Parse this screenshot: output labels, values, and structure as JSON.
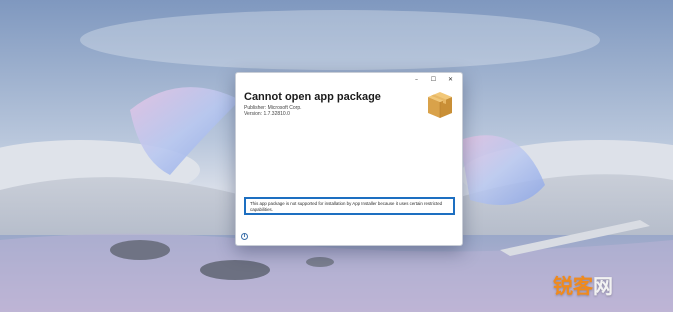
{
  "dialog": {
    "title": "Cannot open app package",
    "publisher": "Publisher: Microsoft Corp.",
    "version": "Version: 1.7.32810.0",
    "message": "This app package is not supported for installation by App Installer because it uses certain restricted capabilities.",
    "controls": {
      "minimize": "–",
      "maximize": "☐",
      "close": "✕"
    },
    "info_icon": "info-icon",
    "package_icon": "package-box-icon"
  },
  "watermark": {
    "part1": "锐客",
    "part2": "网"
  },
  "colors": {
    "accent_blue": "#1d6fc1",
    "watermark_orange": "#f08a1c"
  }
}
